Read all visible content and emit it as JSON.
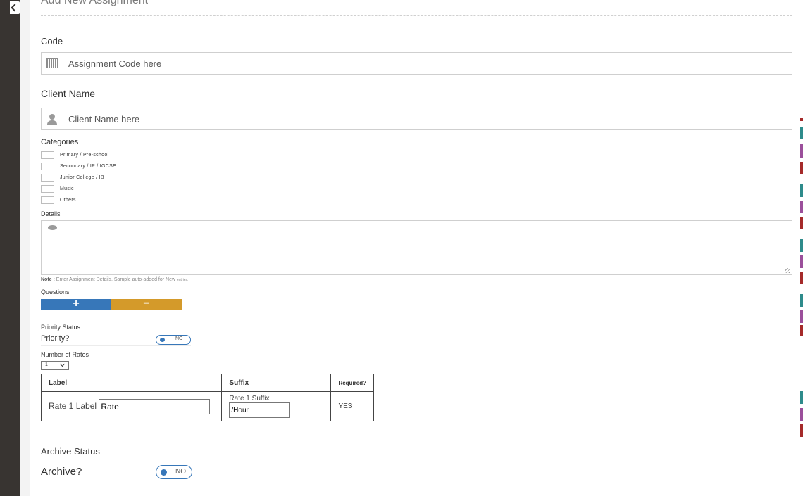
{
  "form": {
    "title": "Add New Assignment",
    "code": {
      "label": "Code",
      "placeholder": "Assignment Code here"
    },
    "client": {
      "label": "Client Name",
      "placeholder": "Client Name here"
    },
    "categories": {
      "label": "Categories",
      "items": [
        "Primary / Pre-school",
        "Secondary / IP / IGCSE",
        "Junior College / IB",
        "Music",
        "Others"
      ]
    },
    "details": {
      "label": "Details",
      "note_bold": "Note :",
      "note_text": "Enter Assignment Details. Sample auto-added for New ",
      "note_small": "entries."
    },
    "questions": {
      "label": "Questions",
      "add": "+",
      "remove": "−"
    },
    "priority": {
      "section": "Priority Status",
      "label": "Priority?",
      "toggle": "NO"
    },
    "rates": {
      "label": "Number of Rates",
      "selected": "1",
      "headers": [
        "Label",
        "Suffix",
        "Required?"
      ],
      "row": {
        "label_text": "Rate 1 Label",
        "label_value": "Rate",
        "suffix_text": "Rate 1 Suffix",
        "suffix_value": "/Hour",
        "required": "YES"
      }
    },
    "archive": {
      "section": "Archive Status",
      "label": "Archive?",
      "toggle": "NO"
    }
  },
  "colors": {
    "primary": "#3777b9",
    "warning": "#d49a2a",
    "sidebar": "#383431"
  },
  "icons": [
    "chevron-left-icon",
    "barcode-icon",
    "user-icon",
    "comment-icon",
    "resize-grip-icon",
    "chevron-down-icon"
  ]
}
